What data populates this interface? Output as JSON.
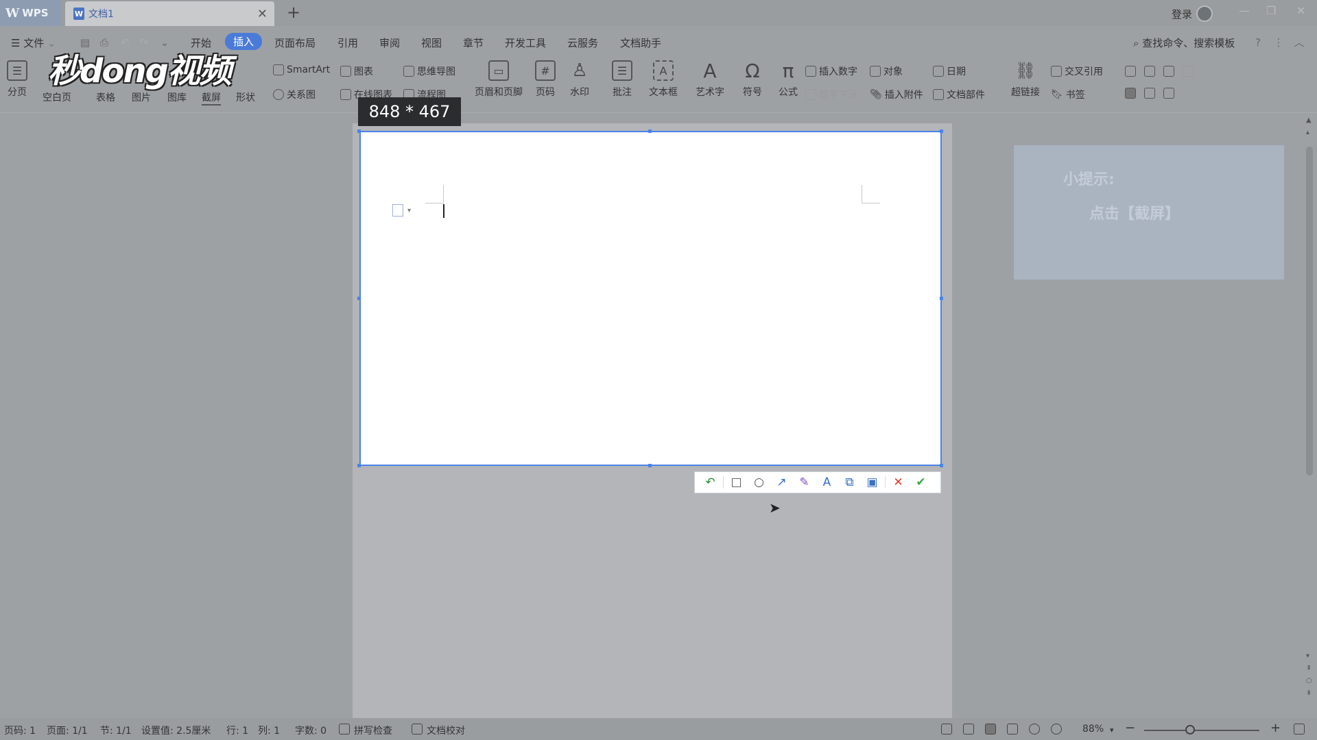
{
  "titlebar": {
    "app_name": "WPS",
    "doc_tab": "文档1",
    "close_tab_symbol": "✕",
    "new_tab_symbol": "+",
    "login": "登录"
  },
  "menu": {
    "file": "文件",
    "tabs": [
      "开始",
      "插入",
      "页面布局",
      "引用",
      "审阅",
      "视图",
      "章节",
      "开发工具",
      "云服务",
      "文档助手"
    ],
    "active_tab": "插入",
    "search": "查找命令、搜索模板"
  },
  "ribbon": {
    "page_break": "分页",
    "blank_page": "空白页",
    "table": "表格",
    "picture": "图片",
    "gallery": "图库",
    "screenshot": "截屏",
    "shape": "形状",
    "smartart": "SmartArt",
    "chart": "图表",
    "mindmap": "思维导图",
    "relation": "关系图",
    "online_chart": "在线图表",
    "flowchart": "流程图",
    "header_footer": "页眉和页脚",
    "page_number": "页码",
    "watermark": "水印",
    "comment": "批注",
    "textbox": "文本框",
    "wordart": "艺术字",
    "symbol": "符号",
    "formula": "公式",
    "insert_number": "插入数字",
    "object": "对象",
    "date": "日期",
    "drop_cap": "首字下沉",
    "attachment": "插入附件",
    "doc_parts": "文档部件",
    "hyperlink": "超链接",
    "cross_ref": "交叉引用",
    "bookmark": "书签"
  },
  "overlay_logo": "秒dong视频",
  "screenshot_capture": {
    "size_label": "848 * 467",
    "toolbar": [
      {
        "name": "undo-tool-icon",
        "glyph": "↶",
        "color": "#2e8b3a"
      },
      {
        "name": "rectangle-tool-icon",
        "glyph": "□",
        "color": "#555555"
      },
      {
        "name": "ellipse-tool-icon",
        "glyph": "○",
        "color": "#555555"
      },
      {
        "name": "arrow-tool-icon",
        "glyph": "↗",
        "color": "#3a6fc4"
      },
      {
        "name": "brush-tool-icon",
        "glyph": "✎",
        "color": "#7a4fc0"
      },
      {
        "name": "text-tool-icon",
        "glyph": "A",
        "color": "#3a6fc4"
      },
      {
        "name": "copy-tool-icon",
        "glyph": "⧉",
        "color": "#3a6fc4"
      },
      {
        "name": "save-tool-icon",
        "glyph": "▣",
        "color": "#3a6fc4"
      },
      {
        "name": "cancel-tool-icon",
        "glyph": "✕",
        "color": "#e0392b"
      },
      {
        "name": "confirm-tool-icon",
        "glyph": "✔",
        "color": "#3aa63a"
      }
    ]
  },
  "tip_panel": {
    "title": "小提示:",
    "text": "点击【截屏】"
  },
  "statusbar": {
    "page_num": "页码: 1",
    "pages": "页面: 1/1",
    "section": "节: 1/1",
    "setting": "设置值: 2.5厘米",
    "row": "行: 1",
    "col": "列: 1",
    "word_count": "字数: 0",
    "spell_check": "拼写检查",
    "doc_proof": "文档校对",
    "zoom": "88%",
    "zoom_fraction": 0.4
  },
  "colors": {
    "accent": "#4a82e8",
    "menu_active": "#4a7bd8"
  }
}
